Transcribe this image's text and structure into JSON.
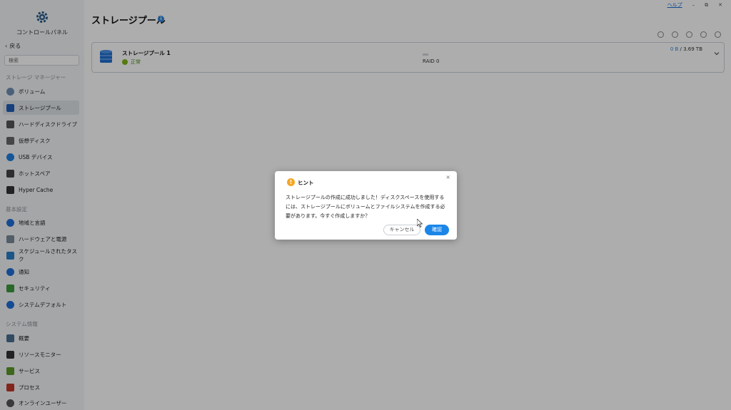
{
  "app": {
    "title": "コントロールパネル",
    "back_label": "戻る"
  },
  "search": {
    "placeholder": "検索"
  },
  "sidebar": {
    "sections": [
      {
        "label": "ストレージ マネージャー"
      },
      {
        "label": "基本設定"
      },
      {
        "label": "システム情報"
      }
    ],
    "items": [
      {
        "label": "ボリューム",
        "color": "#6d8fb3"
      },
      {
        "label": "ストレージプール",
        "color": "#1f5fb8",
        "active": true
      },
      {
        "label": "ハードディスクドライブ",
        "color": "#555555"
      },
      {
        "label": "仮想ディスク",
        "color": "#666666"
      },
      {
        "label": "USB デバイス",
        "color": "#1e7fe0"
      },
      {
        "label": "ホットスペア",
        "color": "#444444"
      },
      {
        "label": "Hyper Cache",
        "color": "#333333"
      },
      {
        "label": "地域と言語",
        "color": "#1e6fd8"
      },
      {
        "label": "ハードウェアと電源",
        "color": "#7a8a99"
      },
      {
        "label": "スケジュールされたタスク",
        "color": "#2a7fc9"
      },
      {
        "label": "通知",
        "color": "#1e6fd8"
      },
      {
        "label": "セキュリティ",
        "color": "#3c9a3c"
      },
      {
        "label": "システムデフォルト",
        "color": "#1e6fd8"
      },
      {
        "label": "概要",
        "color": "#4a6f92"
      },
      {
        "label": "リソースモニター",
        "color": "#333333"
      },
      {
        "label": "サービス",
        "color": "#5a9a2a"
      },
      {
        "label": "プロセス",
        "color": "#c0392b"
      },
      {
        "label": "オンラインユーザー",
        "color": "#555555"
      }
    ]
  },
  "topbar": {
    "help": "ヘルプ",
    "minimize": "–",
    "restore": "⧉",
    "close": "✕"
  },
  "main": {
    "title": "ストレージプール",
    "pool": {
      "name": "ストレージプール 1",
      "status": "正常",
      "used": "0 B",
      "total": " / 3.69 TB",
      "raid": "RAID 0"
    }
  },
  "dialog": {
    "title": "ヒント",
    "icon": "!",
    "close": "×",
    "message": "ストレージプールの作成に成功しました！ディスクスペースを使用するには、ストレージプールにボリュームとファイルシステムを作成する必要があります。今すぐ作成しますか？",
    "cancel": "キャンセル",
    "confirm": "確認"
  }
}
